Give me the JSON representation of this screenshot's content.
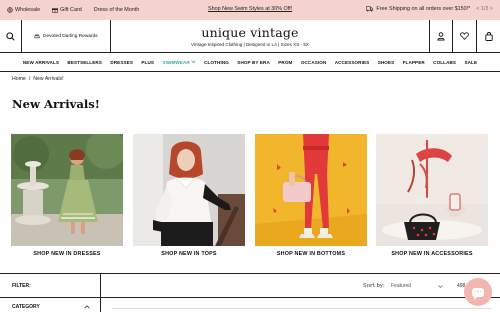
{
  "promo": {
    "wholesale": "Wholesale",
    "gift_card": "Gift Card",
    "dress_of_month": "Dress of the Month",
    "center": "Shop New Swim Styles at 30% Off!",
    "shipping": "Free Shipping on all orders over $150!*",
    "pager": "< 1/3 >"
  },
  "header": {
    "rewards": "Devoted Darling Rewards",
    "logo": "unique vintage",
    "tagline": "Vintage Inspired Clothing | Designed in LA | Sizes XS - 5X"
  },
  "nav": {
    "items": [
      "NEW ARRIVALS",
      "BESTSELLERS",
      "DRESSES",
      "PLUS",
      "SWIMWEAR",
      "CLOTHING",
      "SHOP BY ERA",
      "PROM",
      "OCCASION",
      "ACCESSORIES",
      "SHOES",
      "FLAPPER",
      "COLLABS",
      "SALE"
    ]
  },
  "breadcrumb": {
    "home": "Home",
    "sep": "/",
    "current": "New Arrivals!"
  },
  "page_title": "New Arrivals!",
  "tiles": [
    {
      "label": "SHOP NEW IN DRESSES",
      "icon": "dress-photo"
    },
    {
      "label": "SHOP NEW IN TOPS",
      "icon": "blouse-photo"
    },
    {
      "label": "SHOP NEW IN BOTTOMS",
      "icon": "pants-photo"
    },
    {
      "label": "SHOP NEW IN ACCESSORIES",
      "icon": "accessories-photo"
    }
  ],
  "filters": {
    "filter_label": "FILTER:",
    "sort_label": "Sort by:",
    "sort_value": "Featured",
    "count": "498",
    "category_label": "CATEGORY"
  },
  "colors": {
    "promo_bg": "#f4d3cf",
    "swimwear": "#3aa6a6",
    "chat_bg": "#f2b6ae"
  }
}
